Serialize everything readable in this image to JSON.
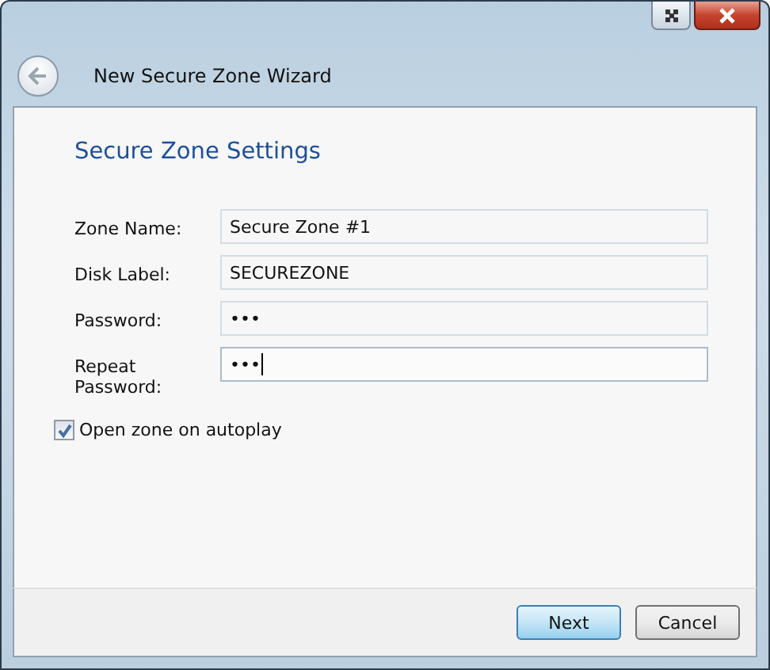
{
  "window": {
    "title": "New Secure Zone Wizard"
  },
  "heading": "Secure Zone Settings",
  "fields": [
    {
      "label": "Zone Name:",
      "value": "Secure Zone #1",
      "focused": false
    },
    {
      "label": "Disk Label:",
      "value": "SECUREZONE",
      "focused": false
    },
    {
      "label": "Password:",
      "value": "•••",
      "focused": false
    },
    {
      "label": "Repeat Password:",
      "value": "•••",
      "focused": true
    }
  ],
  "autoplay": {
    "label": "Open zone on autoplay",
    "checked": true
  },
  "buttons": [
    {
      "label": "Next",
      "default": true
    },
    {
      "label": "Cancel",
      "default": false
    }
  ]
}
